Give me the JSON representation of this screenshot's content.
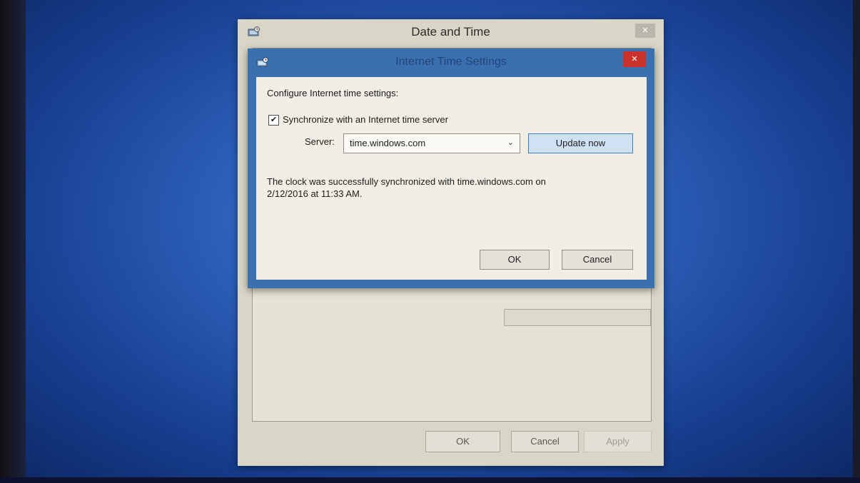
{
  "outer_dialog": {
    "title": "Date and Time",
    "close_label": "×",
    "buttons": {
      "ok": "OK",
      "cancel": "Cancel",
      "apply": "Apply"
    }
  },
  "inner_dialog": {
    "title": "Internet Time Settings",
    "close_label": "×",
    "configure_label": "Configure Internet time settings:",
    "sync_checkbox": {
      "checked": true,
      "check_glyph": "✔",
      "label": "Synchronize with an Internet time server"
    },
    "server": {
      "label": "Server:",
      "value": "time.windows.com",
      "arrow": "⌄"
    },
    "update_button": "Update now",
    "status_line1": "The clock was successfully synchronized with time.windows.com on",
    "status_line2": "2/12/2016 at 11:33 AM.",
    "buttons": {
      "ok": "OK",
      "cancel": "Cancel"
    }
  },
  "icons": {
    "app": "date-time-settings-icon",
    "close": "close-icon",
    "dropdown": "chevron-down-icon",
    "check": "checkmark-icon"
  },
  "colors": {
    "desktop": "#2c5fb8",
    "inner_frame": "#3a6fb0",
    "close_red": "#c9322a",
    "primary_button": "#cfe2f5"
  }
}
